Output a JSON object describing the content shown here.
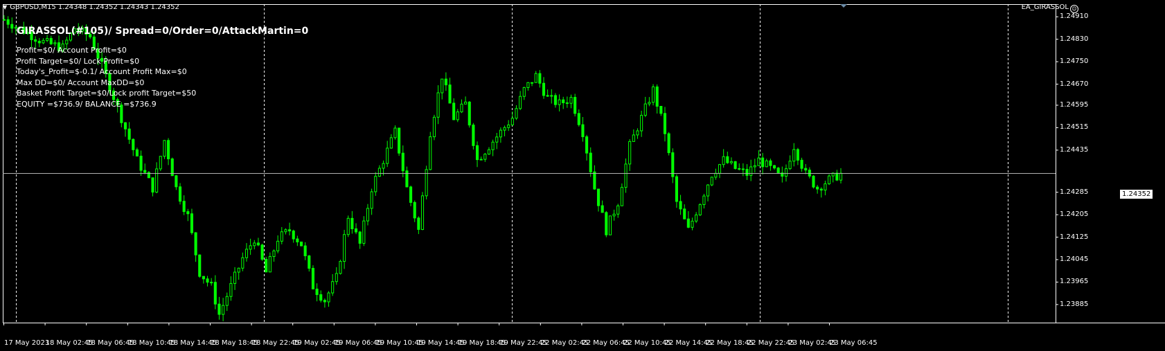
{
  "header": {
    "symbol_line": "GBPUSD,M15  1.24348 1.24352 1.24343 1.24352",
    "ea_name": "EA_GIRASSOL"
  },
  "info_panel": {
    "title": "GIRASSOL(#105)/ Spread=0/Order=0/AttackMartin=0",
    "lines": [
      "Profit=$0/ Account Profit=$0",
      "Profit Target=$0/ Lock Profit=$0",
      "Today's_Profit=$-0.1/ Account Profit Max=$0",
      "Max DD=$0/ Account MaxDD=$0",
      "Basket Profit Target=$0/Lock profit Target=$50",
      "EQUITY =$736.9/ BALANCE =$736.9"
    ]
  },
  "chart_data": {
    "type": "candlestick",
    "symbol": "GBPUSD",
    "timeframe": "M15",
    "current_price": "1.24352",
    "y_ticks": [
      "1.24910",
      "1.24830",
      "1.24750",
      "1.24670",
      "1.24595",
      "1.24515",
      "1.24435",
      "1.24285",
      "1.24205",
      "1.24125",
      "1.24045",
      "1.23965",
      "1.23885"
    ],
    "x_ticks": [
      "17 May 2023",
      "18 May 02:45",
      "18 May 06:45",
      "18 May 10:45",
      "18 May 14:45",
      "18 May 18:45",
      "18 May 22:45",
      "19 May 02:45",
      "19 May 06:45",
      "19 May 10:45",
      "19 May 14:45",
      "19 May 18:45",
      "19 May 22:45",
      "22 May 02:45",
      "22 May 06:45",
      "22 May 10:45",
      "22 May 14:45",
      "22 May 18:45",
      "22 May 22:45",
      "23 May 02:45",
      "23 May 06:45"
    ],
    "ylim": [
      1.23865,
      1.24955
    ],
    "price_path": [
      [
        0,
        1.249
      ],
      [
        5,
        1.2486
      ],
      [
        10,
        1.2482
      ],
      [
        15,
        1.248
      ],
      [
        18,
        1.2487
      ],
      [
        22,
        1.2484
      ],
      [
        26,
        1.247
      ],
      [
        30,
        1.2455
      ],
      [
        34,
        1.244
      ],
      [
        38,
        1.243
      ],
      [
        41,
        1.2447
      ],
      [
        44,
        1.243
      ],
      [
        47,
        1.242
      ],
      [
        50,
        1.24
      ],
      [
        53,
        1.2395
      ],
      [
        55,
        1.2385
      ],
      [
        58,
        1.2395
      ],
      [
        61,
        1.2405
      ],
      [
        64,
        1.2412
      ],
      [
        67,
        1.24
      ],
      [
        70,
        1.2412
      ],
      [
        73,
        1.2415
      ],
      [
        76,
        1.241
      ],
      [
        79,
        1.2395
      ],
      [
        82,
        1.239
      ],
      [
        85,
        1.2398
      ],
      [
        88,
        1.242
      ],
      [
        91,
        1.241
      ],
      [
        94,
        1.243
      ],
      [
        97,
        1.244
      ],
      [
        100,
        1.245
      ],
      [
        103,
        1.243
      ],
      [
        106,
        1.2415
      ],
      [
        109,
        1.245
      ],
      [
        112,
        1.247
      ],
      [
        115,
        1.2455
      ],
      [
        118,
        1.246
      ],
      [
        121,
        1.244
      ],
      [
        124,
        1.2445
      ],
      [
        127,
        1.245
      ],
      [
        130,
        1.2455
      ],
      [
        133,
        1.2465
      ],
      [
        136,
        1.247
      ],
      [
        139,
        1.2462
      ],
      [
        142,
        1.246
      ],
      [
        145,
        1.2462
      ],
      [
        148,
        1.245
      ],
      [
        151,
        1.243
      ],
      [
        154,
        1.2415
      ],
      [
        157,
        1.2425
      ],
      [
        160,
        1.2445
      ],
      [
        163,
        1.2455
      ],
      [
        166,
        1.2465
      ],
      [
        169,
        1.245
      ],
      [
        172,
        1.2425
      ],
      [
        175,
        1.2415
      ],
      [
        178,
        1.2425
      ],
      [
        181,
        1.2435
      ],
      [
        184,
        1.244
      ],
      [
        187,
        1.2437
      ],
      [
        190,
        1.2435
      ],
      [
        193,
        1.244
      ],
      [
        196,
        1.2437
      ],
      [
        199,
        1.2433
      ],
      [
        202,
        1.2445
      ],
      [
        205,
        1.2435
      ],
      [
        208,
        1.243
      ],
      [
        211,
        1.2433
      ],
      [
        214,
        1.2435
      ]
    ]
  },
  "colors": {
    "background": "#000000",
    "candle": "#00ff00",
    "bid_line": "#b0b0b0",
    "grid": "#ffffff"
  }
}
